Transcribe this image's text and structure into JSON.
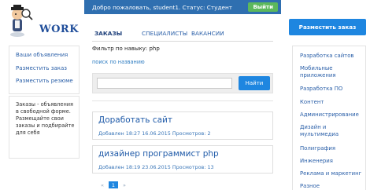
{
  "logo": {
    "text": "WORK",
    "mascot": "mascot-icon"
  },
  "topbar": {
    "welcome": "Добро пожаловать, student1. Статус: Студент",
    "logout_label": "Выйти"
  },
  "place_order_label": "Разместить заказ",
  "tabs": [
    {
      "label": "ЗАКАЗЫ",
      "active": true
    },
    {
      "label": "СПЕЦИАЛИСТЫ",
      "active": false
    },
    {
      "label": "ВАКАНСИИ",
      "active": false
    }
  ],
  "sidebar": {
    "items": [
      {
        "label": "Ваши объявления"
      },
      {
        "label": "Разместить заказ"
      },
      {
        "label": "Разместить резюме"
      }
    ],
    "info": "Заказы - объявления в свободной форме. Размещайте свои заказы и подбирайте для себя"
  },
  "filter": {
    "title": "Фильтр по навыку: php",
    "search_link": "поиск по названию",
    "input_value": "",
    "input_placeholder": "",
    "find_label": "Найти"
  },
  "orders": [
    {
      "title": "Доработать сайт",
      "meta": "Добавлен 18:27 16.06.2015   Просмотров: 2"
    },
    {
      "title": "дизайнер программист php",
      "meta": "Добавлен 18:19 23.06.2015   Просмотров: 13"
    }
  ],
  "pagination": {
    "prev": "«",
    "current": "1",
    "next": "»"
  },
  "categories": [
    {
      "label": "Разработка сайтов"
    },
    {
      "label": "Мобильные приложения"
    },
    {
      "label": "Разработка ПО"
    },
    {
      "label": "Контент"
    },
    {
      "label": "Администрирование"
    },
    {
      "label": "Дизайн и мультимедиа"
    },
    {
      "label": "Полиграфия"
    },
    {
      "label": "Инженерия"
    },
    {
      "label": "Реклама и маркетинг"
    },
    {
      "label": "Разное"
    }
  ],
  "colors": {
    "topbar": "#2f6fb0",
    "accent": "#1e86e0",
    "logout": "#5cb85c",
    "link": "#2a5fa8",
    "logo": "#1f4d9a"
  }
}
